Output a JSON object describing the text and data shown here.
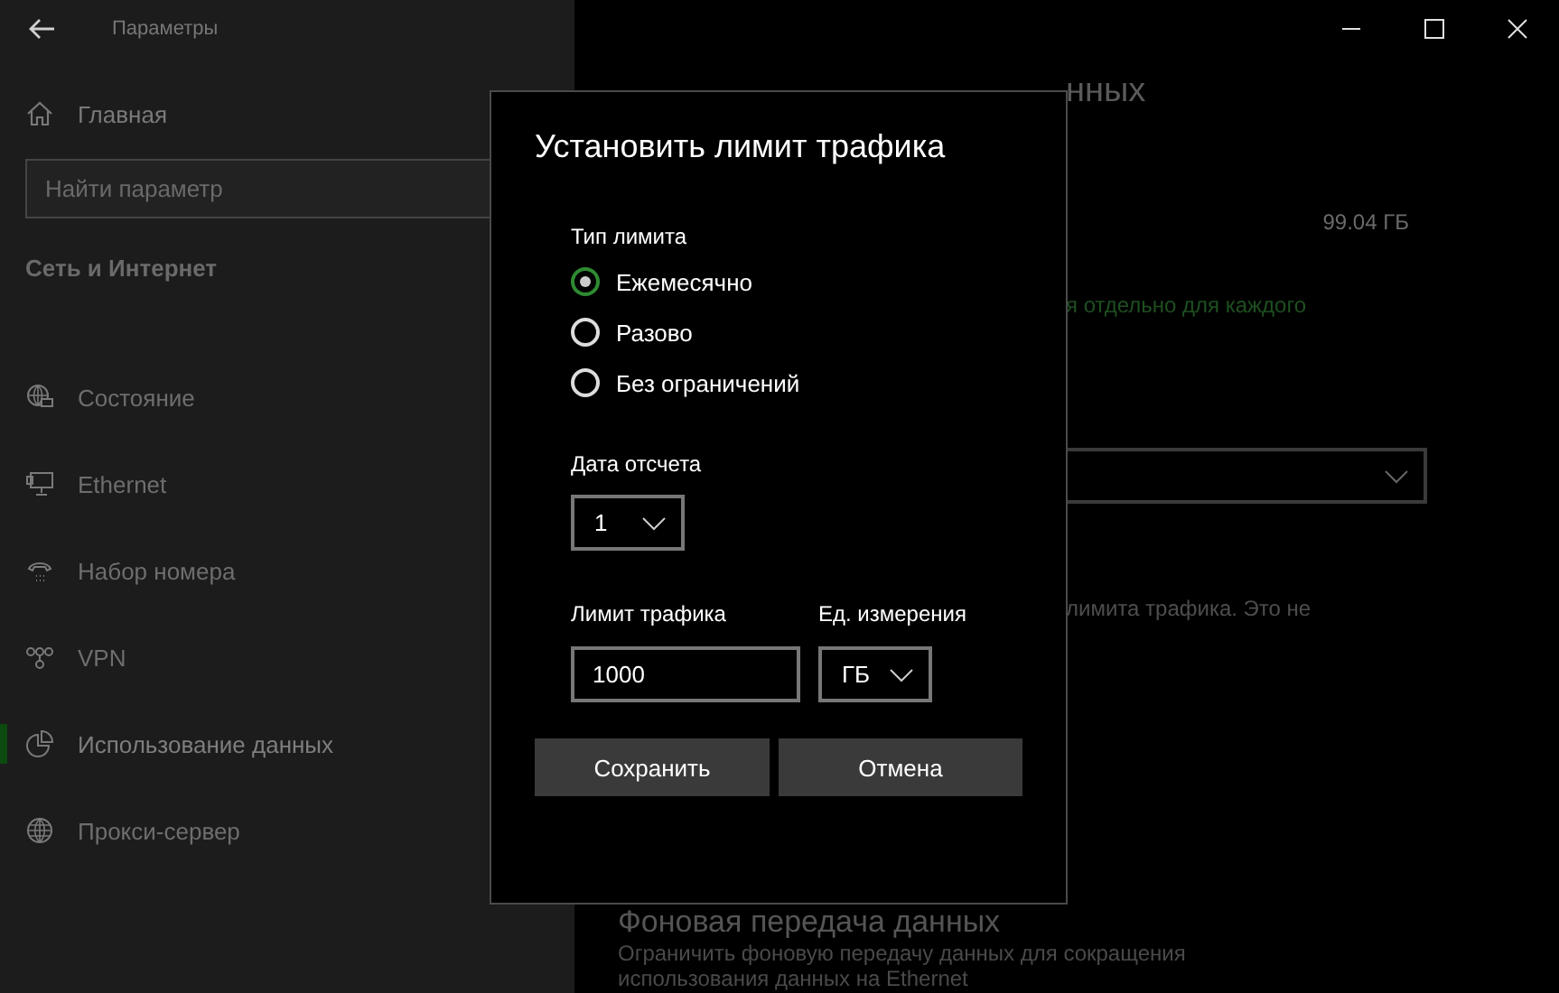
{
  "window": {
    "title": "Параметры"
  },
  "sidebar": {
    "home": "Главная",
    "search": {
      "placeholder": "Найти параметр"
    },
    "section": "Сеть и Интернет",
    "items": [
      {
        "label": "Состояние",
        "selected": false
      },
      {
        "label": "Ethernet",
        "selected": false
      },
      {
        "label": "Набор номера",
        "selected": false
      },
      {
        "label": "VPN",
        "selected": false
      },
      {
        "label": "Использование данных",
        "selected": true
      },
      {
        "label": "Прокси-сервер",
        "selected": false
      }
    ]
  },
  "content": {
    "heading": "нных",
    "usage": "99.04 ГБ",
    "link": "я отдельно для каждого",
    "note": "лимита трафика. Это не",
    "section_title": "Фоновая передача данных",
    "description": "Ограничить фоновую передачу данных для сокращения",
    "description_2": "использования данных на Ethernet"
  },
  "dialog": {
    "title": "Установить лимит трафика",
    "limit_type_label": "Тип лимита",
    "limit_types": [
      {
        "label": "Ежемесячно",
        "selected": true
      },
      {
        "label": "Разово",
        "selected": false
      },
      {
        "label": "Без ограничений",
        "selected": false
      }
    ],
    "reset_date_label": "Дата отсчета",
    "reset_date": "1",
    "limit_label": "Лимит трафика",
    "limit_value": "1000",
    "unit_label": "Ед. измерения",
    "unit": "ГБ",
    "buttons": [
      "Сохранить",
      "Отмена"
    ]
  }
}
